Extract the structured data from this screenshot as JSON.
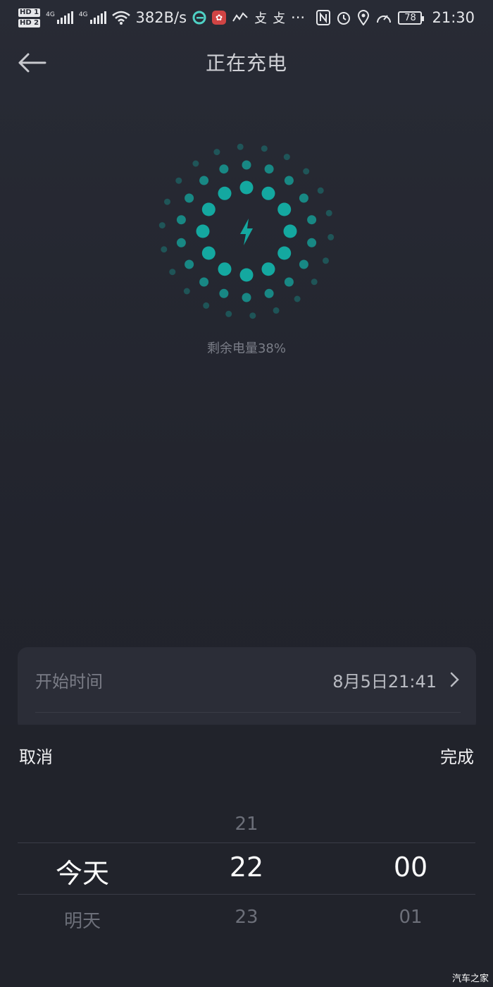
{
  "status_bar": {
    "hd1": "HD 1",
    "hd2": "HD 2",
    "net1": "4G",
    "net2": "4G",
    "speed": "382B/s",
    "app_icons": [
      "e-app-icon",
      "lotus-app-icon",
      "stock-app-icon",
      "alipay-icon",
      "alipay-icon"
    ],
    "more": "···",
    "glyph_1": "攴",
    "glyph_2": "攴",
    "battery": "78",
    "time": "21:30"
  },
  "header": {
    "title": "正在充电",
    "back_icon": "back-arrow-icon"
  },
  "charging": {
    "remaining_text": "剩余电量38%",
    "accent": "#14a8a0",
    "icon": "lightning-bolt-icon"
  },
  "start_time": {
    "label": "开始时间",
    "value": "8月5日21:41"
  },
  "picker": {
    "cancel": "取消",
    "done": "完成",
    "day": {
      "prev": "",
      "selected": "今天",
      "next": "明天"
    },
    "hour": {
      "prev": "21",
      "selected": "22",
      "next": "23"
    },
    "minute": {
      "prev": "",
      "selected": "00",
      "next": "01"
    }
  },
  "watermark": "汽车之家"
}
